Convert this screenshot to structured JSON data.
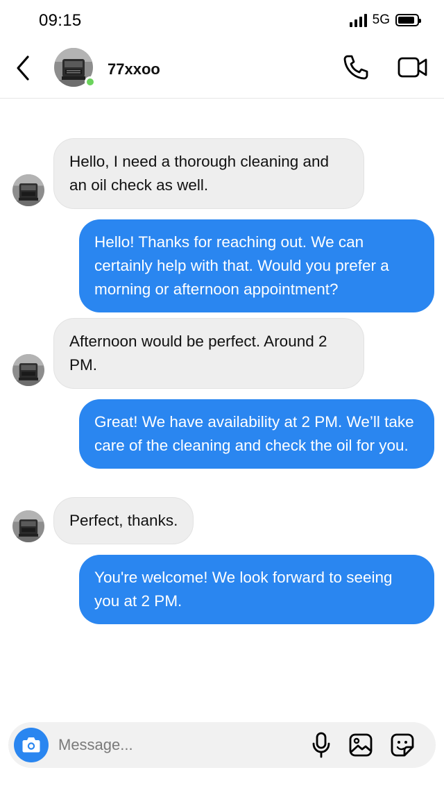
{
  "status_bar": {
    "time": "09:15",
    "network": "5G",
    "battery_level": 0.9
  },
  "header": {
    "contact_name": "77xxoo",
    "online": true,
    "icons": {
      "back": "chevron-left-icon",
      "call": "phone-icon",
      "video": "video-camera-icon"
    }
  },
  "messages": [
    {
      "direction": "incoming",
      "text": "Hello, I need a thorough cleaning and an oil check as well."
    },
    {
      "direction": "outgoing",
      "text": "Hello! Thanks for reaching out. We can certainly help with that. Would you prefer a morning or afternoon appointment?"
    },
    {
      "direction": "incoming",
      "text": "Afternoon would be perfect. Around 2 PM."
    },
    {
      "direction": "outgoing",
      "text": "Great! We have availability at 2 PM. We’ll take care of the cleaning and check the oil for you."
    },
    {
      "direction": "incoming",
      "text": "Perfect, thanks."
    },
    {
      "direction": "outgoing",
      "text": "You're welcome! We look forward to seeing you at 2 PM."
    }
  ],
  "composer": {
    "placeholder": "Message...",
    "icons": {
      "camera": "camera-icon",
      "mic": "microphone-icon",
      "gallery": "image-icon",
      "sticker": "sticker-icon"
    }
  },
  "colors": {
    "outgoing_bubble": "#2a86f0",
    "incoming_bubble": "#eeeeee",
    "online_dot": "#6bd35c",
    "accent": "#2a86f0"
  }
}
